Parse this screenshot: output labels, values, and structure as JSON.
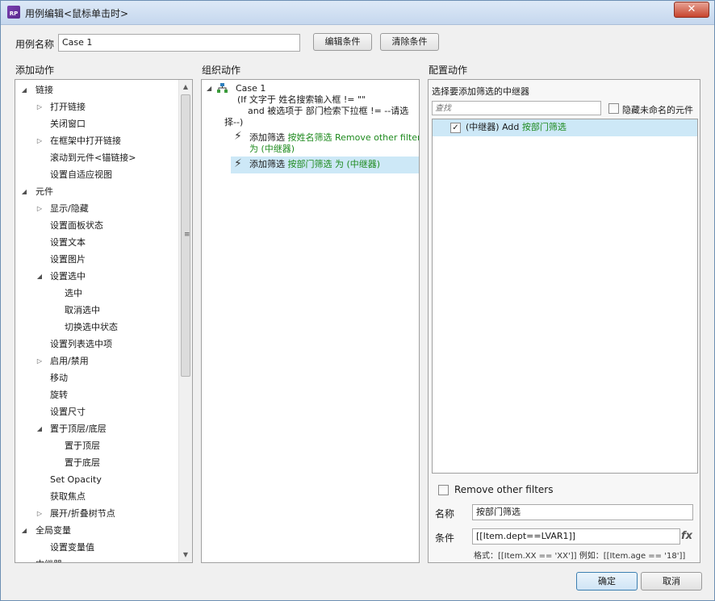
{
  "window": {
    "title": "用例编辑<鼠标单击时>",
    "app_icon": "RP",
    "close_symbol": "✕"
  },
  "case_name": {
    "label": "用例名称",
    "value": "Case 1"
  },
  "buttons": {
    "edit_condition": "编辑条件",
    "clear_condition": "清除条件",
    "ok": "确定",
    "cancel": "取消"
  },
  "add_actions": {
    "header": "添加动作",
    "items": [
      {
        "label": "链接",
        "arrow": "◢"
      },
      {
        "label": "打开链接",
        "arrow": "▷"
      },
      {
        "label": "关闭窗口",
        "arrow": ""
      },
      {
        "label": "在框架中打开链接",
        "arrow": "▷"
      },
      {
        "label": "滚动到元件<锚链接>",
        "arrow": ""
      },
      {
        "label": "设置自适应视图",
        "arrow": ""
      },
      {
        "label": "元件",
        "arrow": "◢"
      },
      {
        "label": "显示/隐藏",
        "arrow": "▷"
      },
      {
        "label": "设置面板状态",
        "arrow": ""
      },
      {
        "label": "设置文本",
        "arrow": ""
      },
      {
        "label": "设置图片",
        "arrow": ""
      },
      {
        "label": "设置选中",
        "arrow": "◢"
      },
      {
        "label": "选中",
        "arrow": ""
      },
      {
        "label": "取消选中",
        "arrow": ""
      },
      {
        "label": "切换选中状态",
        "arrow": ""
      },
      {
        "label": "设置列表选中项",
        "arrow": ""
      },
      {
        "label": "启用/禁用",
        "arrow": "▷"
      },
      {
        "label": "移动",
        "arrow": ""
      },
      {
        "label": "旋转",
        "arrow": ""
      },
      {
        "label": "设置尺寸",
        "arrow": ""
      },
      {
        "label": "置于顶层/底层",
        "arrow": "◢"
      },
      {
        "label": "置于顶层",
        "arrow": ""
      },
      {
        "label": "置于底层",
        "arrow": ""
      },
      {
        "label": "Set Opacity",
        "arrow": ""
      },
      {
        "label": "获取焦点",
        "arrow": ""
      },
      {
        "label": "展开/折叠树节点",
        "arrow": "▷"
      },
      {
        "label": "全局变量",
        "arrow": "◢"
      },
      {
        "label": "设置变量值",
        "arrow": ""
      },
      {
        "label": "中继器",
        "arrow": "◢"
      }
    ],
    "scroll_up": "▲",
    "scroll_down": "▼",
    "thumb_grip": "≡"
  },
  "organize_actions": {
    "header": "组织动作",
    "case_title": "Case 1",
    "case_arrow": "◢",
    "condition_lines": [
      "(If 文字于 姓名搜索输入框 != \"\"",
      "and 被选项于 部门检索下拉框 != --请选",
      "择--)"
    ],
    "actions": [
      {
        "prefix": "添加筛选 ",
        "highlight_lines": [
          "按姓名筛选 Remove other filters",
          "为 (中继器)"
        ]
      },
      {
        "prefix": "添加筛选 ",
        "highlight_lines": [
          "按部门筛选 为 (中继器)"
        ]
      }
    ],
    "bolt_icon": "⚡"
  },
  "configure_actions": {
    "header": "配置动作",
    "select_label": "选择要添加筛选的中继器",
    "search_placeholder": "查找",
    "hide_unnamed_label": "隐藏未命名的元件",
    "repeater_item": {
      "checked": true,
      "prefix": "(中继器) Add ",
      "highlight": "按部门筛选",
      "check_mark": "✓"
    },
    "remove_other_filters_label": "Remove other filters",
    "name_label": "名称",
    "name_value": "按部门筛选",
    "condition_label": "条件",
    "condition_value": "[[Item.dept==LVAR1]]",
    "fx_label": "fx",
    "format_hint": "格式：[[Item.XX == 'XX']] 例如：[[Item.age == '18']]"
  }
}
